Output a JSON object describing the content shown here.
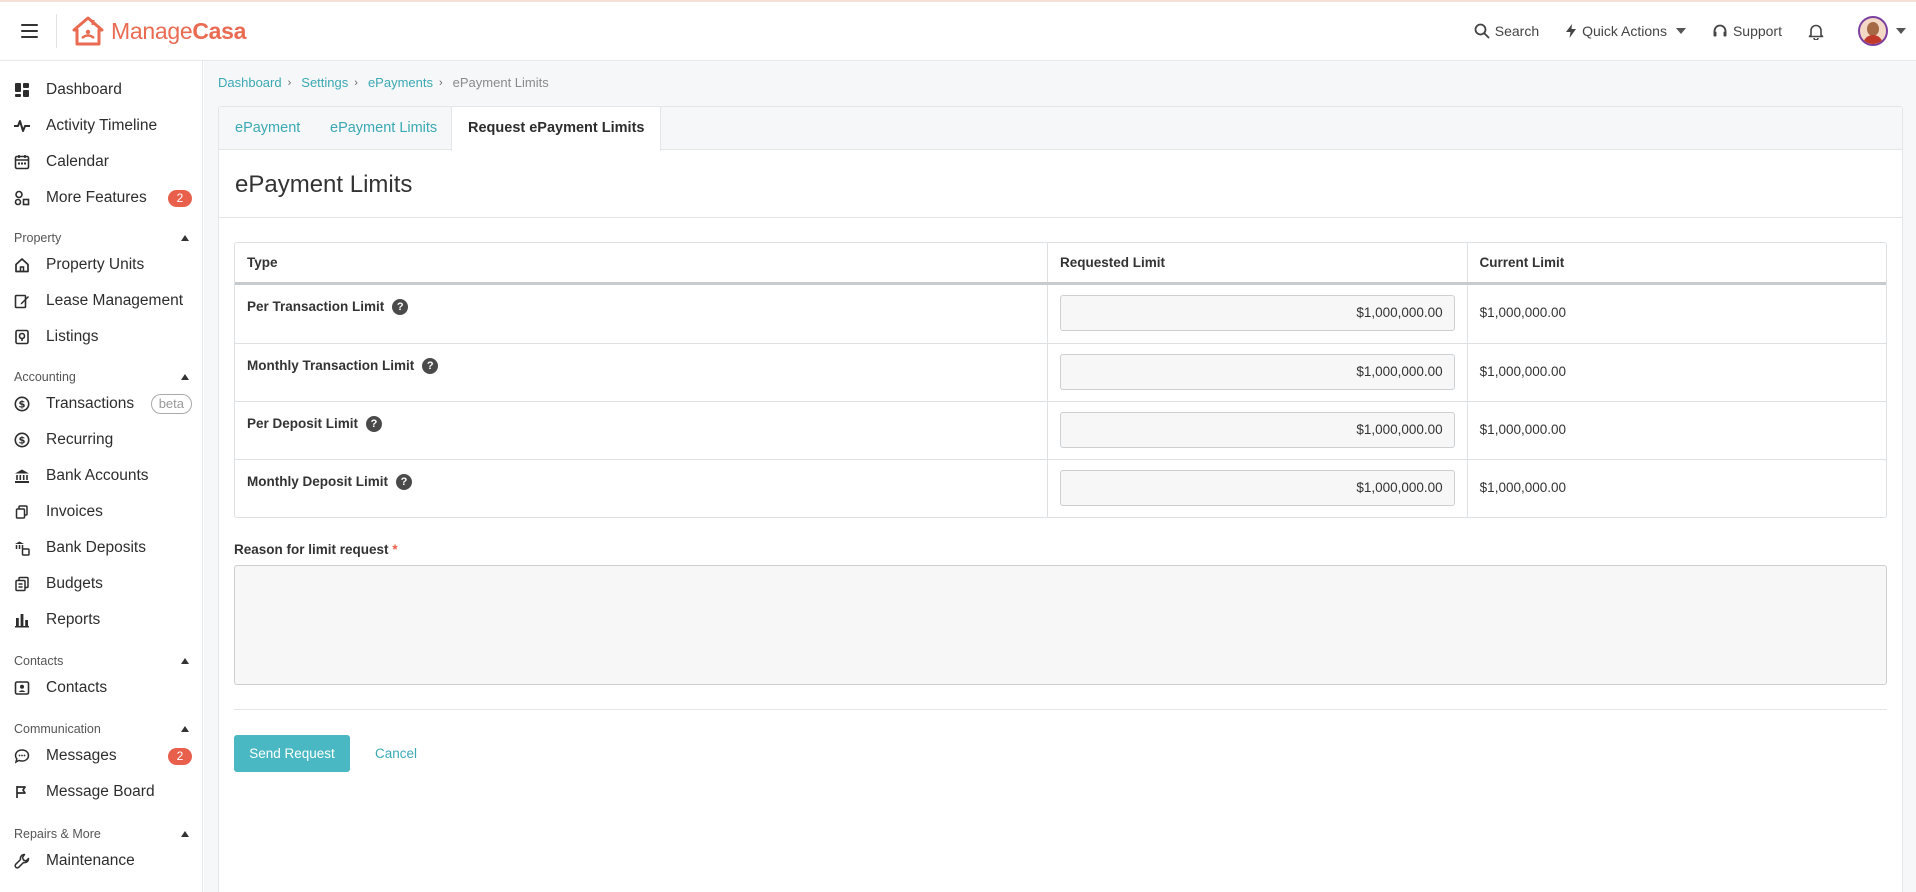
{
  "app": {
    "logo_manage": "Manage",
    "logo_casa": "Casa",
    "brand_color": "#ea6a52",
    "accent_color": "#49b8c2"
  },
  "topbar": {
    "search_label": "Search",
    "quick_actions_label": "Quick Actions",
    "support_label": "Support"
  },
  "sidebar": {
    "dashboard": "Dashboard",
    "activity_timeline": "Activity Timeline",
    "calendar": "Calendar",
    "more_features": "More Features",
    "more_features_badge": "2",
    "section_property": "Property",
    "property_units": "Property Units",
    "lease_management": "Lease Management",
    "listings": "Listings",
    "section_accounting": "Accounting",
    "transactions": "Transactions",
    "transactions_tag": "beta",
    "recurring": "Recurring",
    "bank_accounts": "Bank Accounts",
    "invoices": "Invoices",
    "bank_deposits": "Bank Deposits",
    "budgets": "Budgets",
    "reports": "Reports",
    "section_contacts": "Contacts",
    "contacts": "Contacts",
    "section_communication": "Communication",
    "messages": "Messages",
    "messages_badge": "2",
    "message_board": "Message Board",
    "section_repairs": "Repairs & More",
    "maintenance": "Maintenance"
  },
  "breadcrumb": {
    "dashboard": "Dashboard",
    "settings": "Settings",
    "epayments": "ePayments",
    "current": "ePayment Limits"
  },
  "tabs": {
    "epayment": "ePayment",
    "epayment_limits": "ePayment Limits",
    "request_limits": "Request ePayment Limits"
  },
  "page": {
    "title": "ePayment Limits"
  },
  "limits_table": {
    "col_type": "Type",
    "col_requested": "Requested Limit",
    "col_current": "Current Limit",
    "help_glyph": "?",
    "rows": [
      {
        "type": "Per Transaction Limit",
        "requested": "$1,000,000.00",
        "current": "$1,000,000.00"
      },
      {
        "type": "Monthly Transaction Limit",
        "requested": "$1,000,000.00",
        "current": "$1,000,000.00"
      },
      {
        "type": "Per Deposit Limit",
        "requested": "$1,000,000.00",
        "current": "$1,000,000.00"
      },
      {
        "type": "Monthly Deposit Limit",
        "requested": "$1,000,000.00",
        "current": "$1,000,000.00"
      }
    ]
  },
  "form": {
    "reason_label": "Reason for limit request",
    "required_mark": "*",
    "reason_value": "",
    "send_label": "Send Request",
    "cancel_label": "Cancel"
  }
}
